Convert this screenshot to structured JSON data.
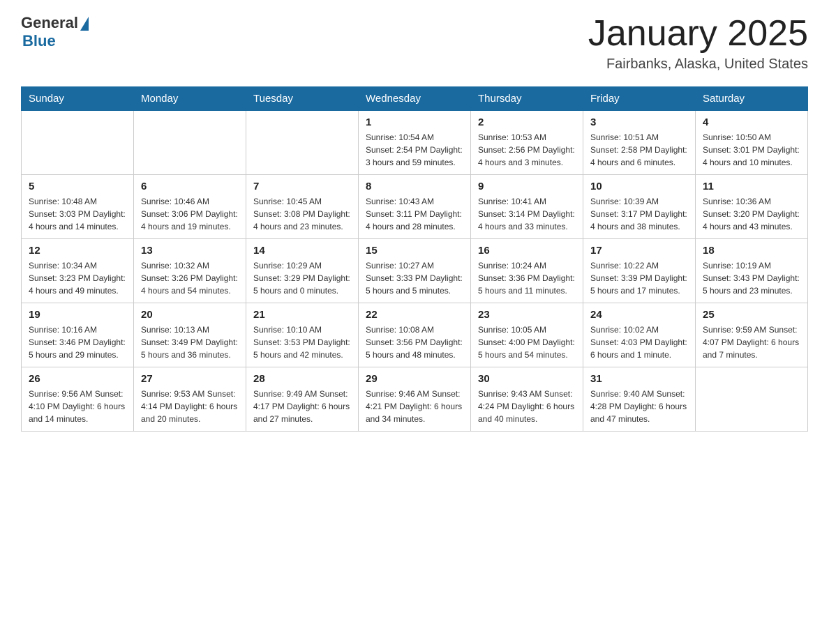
{
  "header": {
    "logo_general": "General",
    "logo_blue": "Blue",
    "main_title": "January 2025",
    "subtitle": "Fairbanks, Alaska, United States"
  },
  "weekdays": [
    "Sunday",
    "Monday",
    "Tuesday",
    "Wednesday",
    "Thursday",
    "Friday",
    "Saturday"
  ],
  "rows": [
    [
      {
        "day": "",
        "info": ""
      },
      {
        "day": "",
        "info": ""
      },
      {
        "day": "",
        "info": ""
      },
      {
        "day": "1",
        "info": "Sunrise: 10:54 AM\nSunset: 2:54 PM\nDaylight: 3 hours\nand 59 minutes."
      },
      {
        "day": "2",
        "info": "Sunrise: 10:53 AM\nSunset: 2:56 PM\nDaylight: 4 hours\nand 3 minutes."
      },
      {
        "day": "3",
        "info": "Sunrise: 10:51 AM\nSunset: 2:58 PM\nDaylight: 4 hours\nand 6 minutes."
      },
      {
        "day": "4",
        "info": "Sunrise: 10:50 AM\nSunset: 3:01 PM\nDaylight: 4 hours\nand 10 minutes."
      }
    ],
    [
      {
        "day": "5",
        "info": "Sunrise: 10:48 AM\nSunset: 3:03 PM\nDaylight: 4 hours\nand 14 minutes."
      },
      {
        "day": "6",
        "info": "Sunrise: 10:46 AM\nSunset: 3:06 PM\nDaylight: 4 hours\nand 19 minutes."
      },
      {
        "day": "7",
        "info": "Sunrise: 10:45 AM\nSunset: 3:08 PM\nDaylight: 4 hours\nand 23 minutes."
      },
      {
        "day": "8",
        "info": "Sunrise: 10:43 AM\nSunset: 3:11 PM\nDaylight: 4 hours\nand 28 minutes."
      },
      {
        "day": "9",
        "info": "Sunrise: 10:41 AM\nSunset: 3:14 PM\nDaylight: 4 hours\nand 33 minutes."
      },
      {
        "day": "10",
        "info": "Sunrise: 10:39 AM\nSunset: 3:17 PM\nDaylight: 4 hours\nand 38 minutes."
      },
      {
        "day": "11",
        "info": "Sunrise: 10:36 AM\nSunset: 3:20 PM\nDaylight: 4 hours\nand 43 minutes."
      }
    ],
    [
      {
        "day": "12",
        "info": "Sunrise: 10:34 AM\nSunset: 3:23 PM\nDaylight: 4 hours\nand 49 minutes."
      },
      {
        "day": "13",
        "info": "Sunrise: 10:32 AM\nSunset: 3:26 PM\nDaylight: 4 hours\nand 54 minutes."
      },
      {
        "day": "14",
        "info": "Sunrise: 10:29 AM\nSunset: 3:29 PM\nDaylight: 5 hours\nand 0 minutes."
      },
      {
        "day": "15",
        "info": "Sunrise: 10:27 AM\nSunset: 3:33 PM\nDaylight: 5 hours\nand 5 minutes."
      },
      {
        "day": "16",
        "info": "Sunrise: 10:24 AM\nSunset: 3:36 PM\nDaylight: 5 hours\nand 11 minutes."
      },
      {
        "day": "17",
        "info": "Sunrise: 10:22 AM\nSunset: 3:39 PM\nDaylight: 5 hours\nand 17 minutes."
      },
      {
        "day": "18",
        "info": "Sunrise: 10:19 AM\nSunset: 3:43 PM\nDaylight: 5 hours\nand 23 minutes."
      }
    ],
    [
      {
        "day": "19",
        "info": "Sunrise: 10:16 AM\nSunset: 3:46 PM\nDaylight: 5 hours\nand 29 minutes."
      },
      {
        "day": "20",
        "info": "Sunrise: 10:13 AM\nSunset: 3:49 PM\nDaylight: 5 hours\nand 36 minutes."
      },
      {
        "day": "21",
        "info": "Sunrise: 10:10 AM\nSunset: 3:53 PM\nDaylight: 5 hours\nand 42 minutes."
      },
      {
        "day": "22",
        "info": "Sunrise: 10:08 AM\nSunset: 3:56 PM\nDaylight: 5 hours\nand 48 minutes."
      },
      {
        "day": "23",
        "info": "Sunrise: 10:05 AM\nSunset: 4:00 PM\nDaylight: 5 hours\nand 54 minutes."
      },
      {
        "day": "24",
        "info": "Sunrise: 10:02 AM\nSunset: 4:03 PM\nDaylight: 6 hours\nand 1 minute."
      },
      {
        "day": "25",
        "info": "Sunrise: 9:59 AM\nSunset: 4:07 PM\nDaylight: 6 hours\nand 7 minutes."
      }
    ],
    [
      {
        "day": "26",
        "info": "Sunrise: 9:56 AM\nSunset: 4:10 PM\nDaylight: 6 hours\nand 14 minutes."
      },
      {
        "day": "27",
        "info": "Sunrise: 9:53 AM\nSunset: 4:14 PM\nDaylight: 6 hours\nand 20 minutes."
      },
      {
        "day": "28",
        "info": "Sunrise: 9:49 AM\nSunset: 4:17 PM\nDaylight: 6 hours\nand 27 minutes."
      },
      {
        "day": "29",
        "info": "Sunrise: 9:46 AM\nSunset: 4:21 PM\nDaylight: 6 hours\nand 34 minutes."
      },
      {
        "day": "30",
        "info": "Sunrise: 9:43 AM\nSunset: 4:24 PM\nDaylight: 6 hours\nand 40 minutes."
      },
      {
        "day": "31",
        "info": "Sunrise: 9:40 AM\nSunset: 4:28 PM\nDaylight: 6 hours\nand 47 minutes."
      },
      {
        "day": "",
        "info": ""
      }
    ]
  ]
}
